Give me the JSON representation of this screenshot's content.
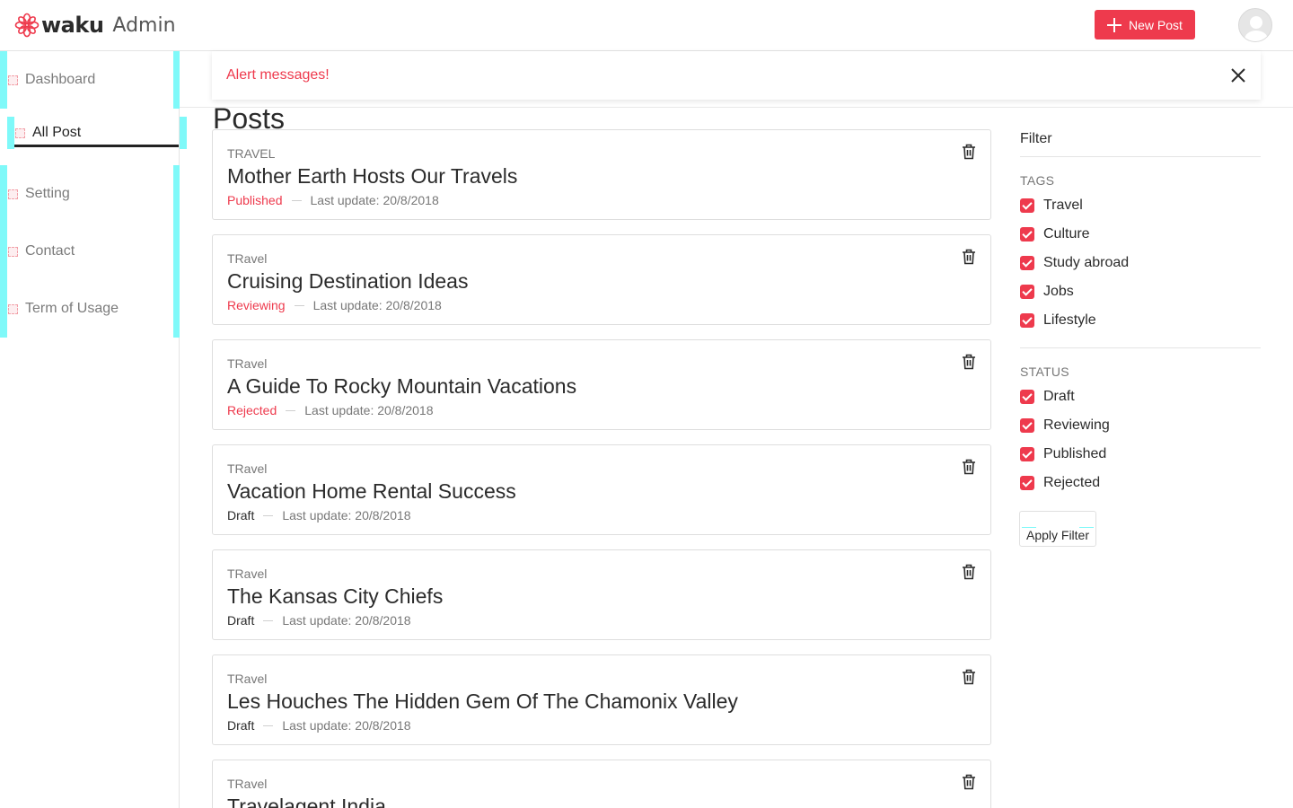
{
  "header": {
    "brand": "waku",
    "brand_suffix": "Admin",
    "new_post_label": "New Post",
    "accent_color": "#ee3a4d"
  },
  "sidebar": {
    "items": [
      {
        "label": "Dashboard",
        "icon": "menu-icon"
      },
      {
        "label": "All Post",
        "icon": "menu-icon",
        "active": true
      },
      {
        "label": "Setting",
        "icon": "menu-icon"
      },
      {
        "label": "Contact",
        "icon": "menu-icon"
      },
      {
        "label": "Term of Usage",
        "icon": "menu-icon"
      }
    ]
  },
  "alert": {
    "message": "Alert messages!"
  },
  "page": {
    "title": "Posts"
  },
  "posts": [
    {
      "tag": "TRAVEL",
      "title": "Mother Earth Hosts Our Travels",
      "status": "Published",
      "last_update": "Last update: 20/8/2018"
    },
    {
      "tag": "TRavel",
      "title": "Cruising Destination Ideas",
      "status": "Reviewing",
      "last_update": "Last update: 20/8/2018"
    },
    {
      "tag": "TRavel",
      "title": "A Guide To Rocky Mountain Vacations",
      "status": "Rejected",
      "last_update": "Last update: 20/8/2018"
    },
    {
      "tag": "TRavel",
      "title": "Vacation Home Rental Success",
      "status": "Draft",
      "last_update": "Last update: 20/8/2018"
    },
    {
      "tag": "TRavel",
      "title": "The Kansas City Chiefs",
      "status": "Draft",
      "last_update": "Last update: 20/8/2018"
    },
    {
      "tag": "TRavel",
      "title": "Les Houches The Hidden Gem Of The Chamonix Valley",
      "status": "Draft",
      "last_update": "Last update: 20/8/2018"
    },
    {
      "tag": "TRavel",
      "title": "Travelagent India",
      "status": "",
      "last_update": ""
    }
  ],
  "filter": {
    "title": "Filter",
    "tags_label": "TAGS",
    "tags": [
      "Travel",
      "Culture",
      "Study abroad",
      "Jobs",
      "Lifestyle"
    ],
    "status_label": "STATUS",
    "statuses": [
      "Draft",
      "Reviewing",
      "Published",
      "Rejected"
    ],
    "apply_label": "Apply Filter"
  }
}
